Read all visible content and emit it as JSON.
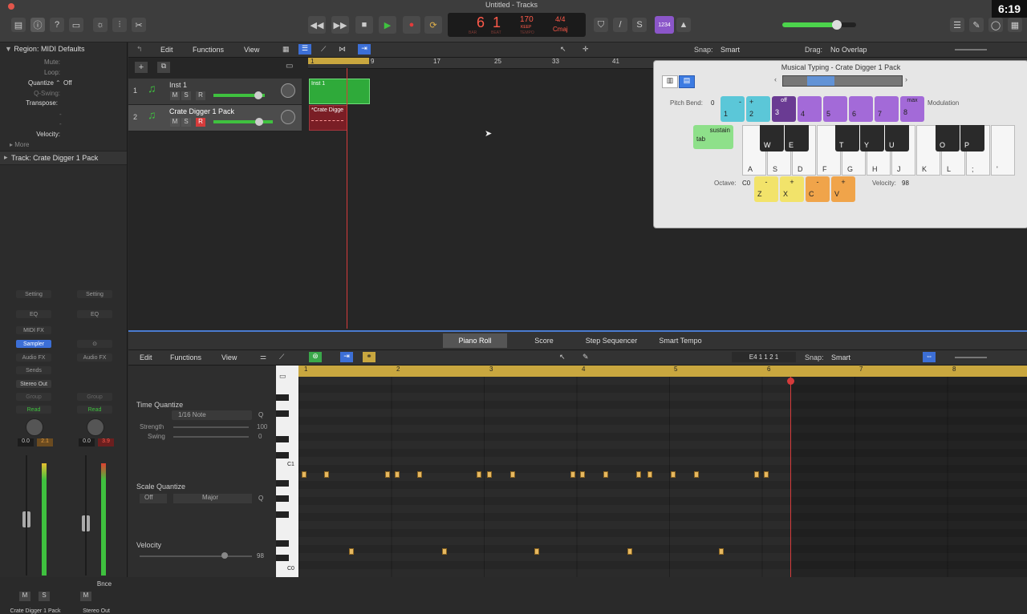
{
  "window_title": "Untitled - Tracks",
  "clock": "6:19",
  "lcd": {
    "bar": "6",
    "beat": "1",
    "bar_label": "BAR",
    "beat_label": "BEAT",
    "tempo": "170",
    "tempo_label": "KEEP",
    "tempo_sub": "TEMPO",
    "signature": "4/4",
    "key": "Cmaj"
  },
  "cpu_label": "1234",
  "inspector": {
    "region_title": "Region: MIDI Defaults",
    "rows": [
      {
        "label": "Mute:",
        "value": ""
      },
      {
        "label": "Loop:",
        "value": ""
      },
      {
        "label": "Quantize",
        "value": "Off"
      },
      {
        "label": "Q-Swing:",
        "value": ""
      },
      {
        "label": "Transpose:",
        "value": ""
      },
      {
        "label": "",
        "value": "-"
      },
      {
        "label": "",
        "value": "-"
      },
      {
        "label": "Velocity:",
        "value": ""
      }
    ],
    "more": "More",
    "track_title": "Track:  Crate Digger 1 Pack"
  },
  "tracks_menu": [
    "Edit",
    "Functions",
    "View"
  ],
  "ruler_marks": [
    "1",
    "9",
    "17",
    "25",
    "33",
    "41"
  ],
  "tracks": [
    {
      "num": "1",
      "name": "Inst 1",
      "region": "Inst 1"
    },
    {
      "num": "2",
      "name": "Crate Digger 1 Pack",
      "region": "*Crate Digge"
    }
  ],
  "mute": "M",
  "solo": "S",
  "rec": "R",
  "snap": {
    "label": "Snap:",
    "value": "Smart"
  },
  "drag": {
    "label": "Drag:",
    "value": "No Overlap"
  },
  "musical_typing": {
    "title": "Musical Typing - Crate Digger 1 Pack",
    "pitch_bend_label": "Pitch Bend:",
    "pitch_bend_value": "0",
    "modulation_label": "Modulation",
    "num_keys": [
      {
        "top": "-",
        "bottom": "1",
        "color": "#5bc7d8"
      },
      {
        "top": "+",
        "bottom": "2",
        "color": "#5bc7d8"
      },
      {
        "top": "off",
        "bottom": "3",
        "color": "#6a3b93"
      },
      {
        "top": "",
        "bottom": "4",
        "color": "#a36ad8"
      },
      {
        "top": "",
        "bottom": "5",
        "color": "#a36ad8"
      },
      {
        "top": "",
        "bottom": "6",
        "color": "#a36ad8"
      },
      {
        "top": "",
        "bottom": "7",
        "color": "#a36ad8"
      },
      {
        "top": "max",
        "bottom": "8",
        "color": "#a36ad8"
      }
    ],
    "sustain_label": "sustain",
    "sustain_key": "tab",
    "white_keys": [
      "A",
      "S",
      "D",
      "F",
      "G",
      "H",
      "J",
      "K",
      "L",
      ";",
      "'"
    ],
    "black_keys": [
      "W",
      "E",
      "T",
      "Y",
      "U",
      "O",
      "P"
    ],
    "octave_label": "Octave:",
    "octave_value": "C0",
    "octave_keys": [
      {
        "top": "-",
        "bottom": "Z",
        "color": "#f2e36a"
      },
      {
        "top": "+",
        "bottom": "X",
        "color": "#f2e36a"
      },
      {
        "top": "-",
        "bottom": "C",
        "color": "#f0a44a"
      },
      {
        "top": "+",
        "bottom": "V",
        "color": "#f0a44a"
      }
    ],
    "velocity_label": "Velocity:",
    "velocity_value": "98"
  },
  "editor_tabs": [
    "Piano Roll",
    "Score",
    "Step Sequencer",
    "Smart Tempo"
  ],
  "pr_menu": [
    "Edit",
    "Functions",
    "View"
  ],
  "pr_position": "E4   1 1 2 1",
  "pr_snap": {
    "label": "Snap:",
    "value": "Smart"
  },
  "pr_ruler": [
    "1",
    "2",
    "3",
    "4",
    "5",
    "6",
    "7",
    "8"
  ],
  "time_quantize": {
    "title": "Time Quantize",
    "value": "1/16 Note",
    "strength_label": "Strength",
    "strength_value": "100",
    "swing_label": "Swing",
    "swing_value": "0",
    "q": "Q"
  },
  "scale_quantize": {
    "title": "Scale Quantize",
    "off": "Off",
    "scale": "Major",
    "q": "Q"
  },
  "velocity": {
    "title": "Velocity",
    "value": "98"
  },
  "keyboard_labels": {
    "c1": "C1",
    "c0": "C0"
  },
  "mixer": {
    "strips": [
      {
        "setting": "Setting",
        "eq": "EQ",
        "midi_fx": "MIDI FX",
        "instrument": "Sampler",
        "audio_fx": "Audio FX",
        "sends": "Sends",
        "output": "Stereo Out",
        "group": "Group",
        "automation": "Read",
        "pan_val": "0.0",
        "peak": "2.1",
        "m": "M",
        "s": "S",
        "name": "Crate Digger 1 Pack"
      },
      {
        "setting": "Setting",
        "eq": "EQ",
        "audio_fx": "Audio FX",
        "group": "Group",
        "automation": "Read",
        "pan_val": "0.0",
        "peak": "3.9",
        "m": "M",
        "bnce": "Bnce",
        "name": "Stereo Out"
      }
    ]
  }
}
